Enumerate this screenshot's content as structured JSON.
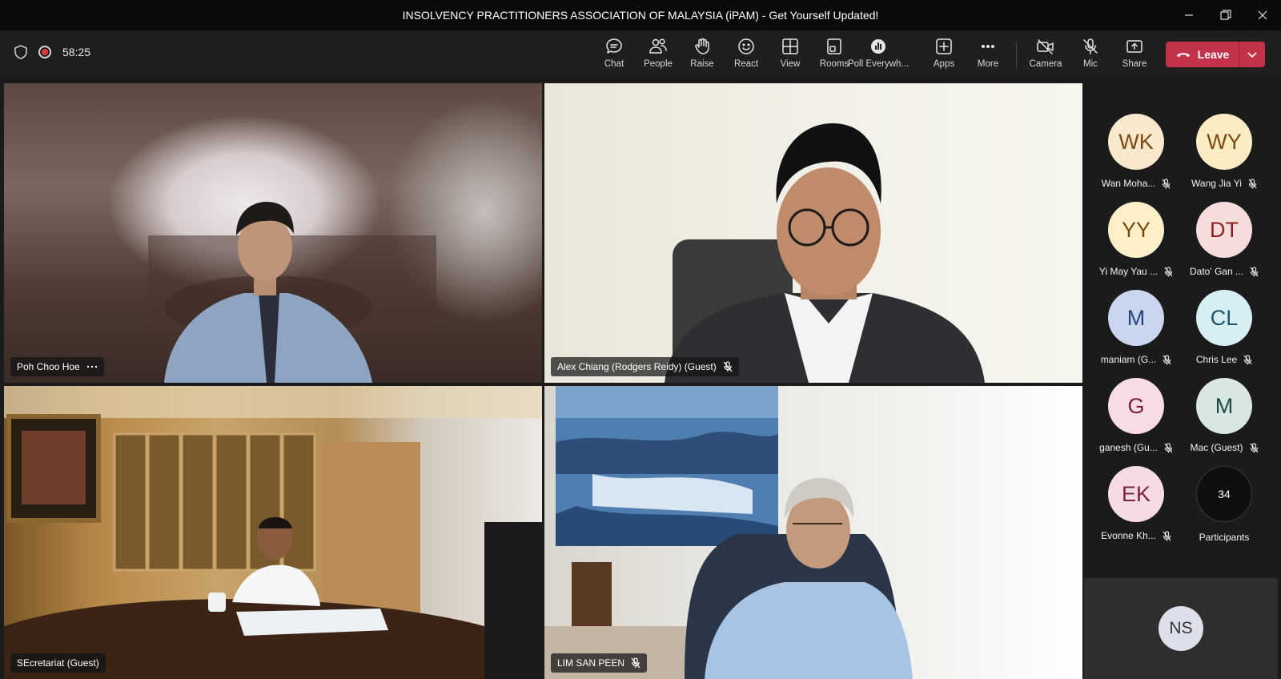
{
  "window": {
    "title": "INSOLVENCY PRACTITIONERS ASSOCIATION OF MALAYSIA (iPAM) - Get Yourself Updated!"
  },
  "toolbar": {
    "timer": "58:25",
    "buttons": {
      "chat": "Chat",
      "people": "People",
      "raise": "Raise",
      "react": "React",
      "view": "View",
      "rooms": "Rooms",
      "poll": "Poll Everywh...",
      "apps": "Apps",
      "more": "More",
      "camera": "Camera",
      "mic": "Mic",
      "share": "Share"
    },
    "leave_label": "Leave",
    "leave_color": "#c4314b"
  },
  "tiles": [
    {
      "name": "Poh Choo Hoe",
      "muted": false,
      "has_more": true
    },
    {
      "name": "Alex Chiang (Rodgers Reidy) (Guest)",
      "muted": true
    },
    {
      "name": "SEcretariat (Guest)",
      "muted": false
    },
    {
      "name": "LIM SAN PEEN",
      "muted": true
    }
  ],
  "roster": [
    {
      "initials": "WK",
      "name": "Wan Moha...",
      "muted": true,
      "bg": "#fae8cc",
      "fg": "#7a4a12"
    },
    {
      "initials": "WY",
      "name": "Wang Jia Yi",
      "muted": true,
      "bg": "#fcecc4",
      "fg": "#7a4a12"
    },
    {
      "initials": "YY",
      "name": "Yi May Yau ...",
      "muted": true,
      "bg": "#fdf0c8",
      "fg": "#7a4a12"
    },
    {
      "initials": "DT",
      "name": "Dato' Gan ...",
      "muted": true,
      "bg": "#f7dcdc",
      "fg": "#8c1f1f"
    },
    {
      "initials": "M",
      "name": "maniam (G...",
      "muted": true,
      "bg": "#c9d6ee",
      "fg": "#28447a"
    },
    {
      "initials": "CL",
      "name": "Chris Lee",
      "muted": true,
      "bg": "#d6eef4",
      "fg": "#1f5565"
    },
    {
      "initials": "G",
      "name": "ganesh (Gu...",
      "muted": true,
      "bg": "#f7dce4",
      "fg": "#7a2040"
    },
    {
      "initials": "M",
      "name": "Mac (Guest)",
      "muted": true,
      "bg": "#d8e6e4",
      "fg": "#1f4a45"
    },
    {
      "initials": "EK",
      "name": "Evonne Kh...",
      "muted": true,
      "bg": "#f6dce2",
      "fg": "#7a2040"
    }
  ],
  "participants": {
    "count": "34",
    "label": "Participants"
  },
  "self_view": {
    "initials": "NS"
  }
}
